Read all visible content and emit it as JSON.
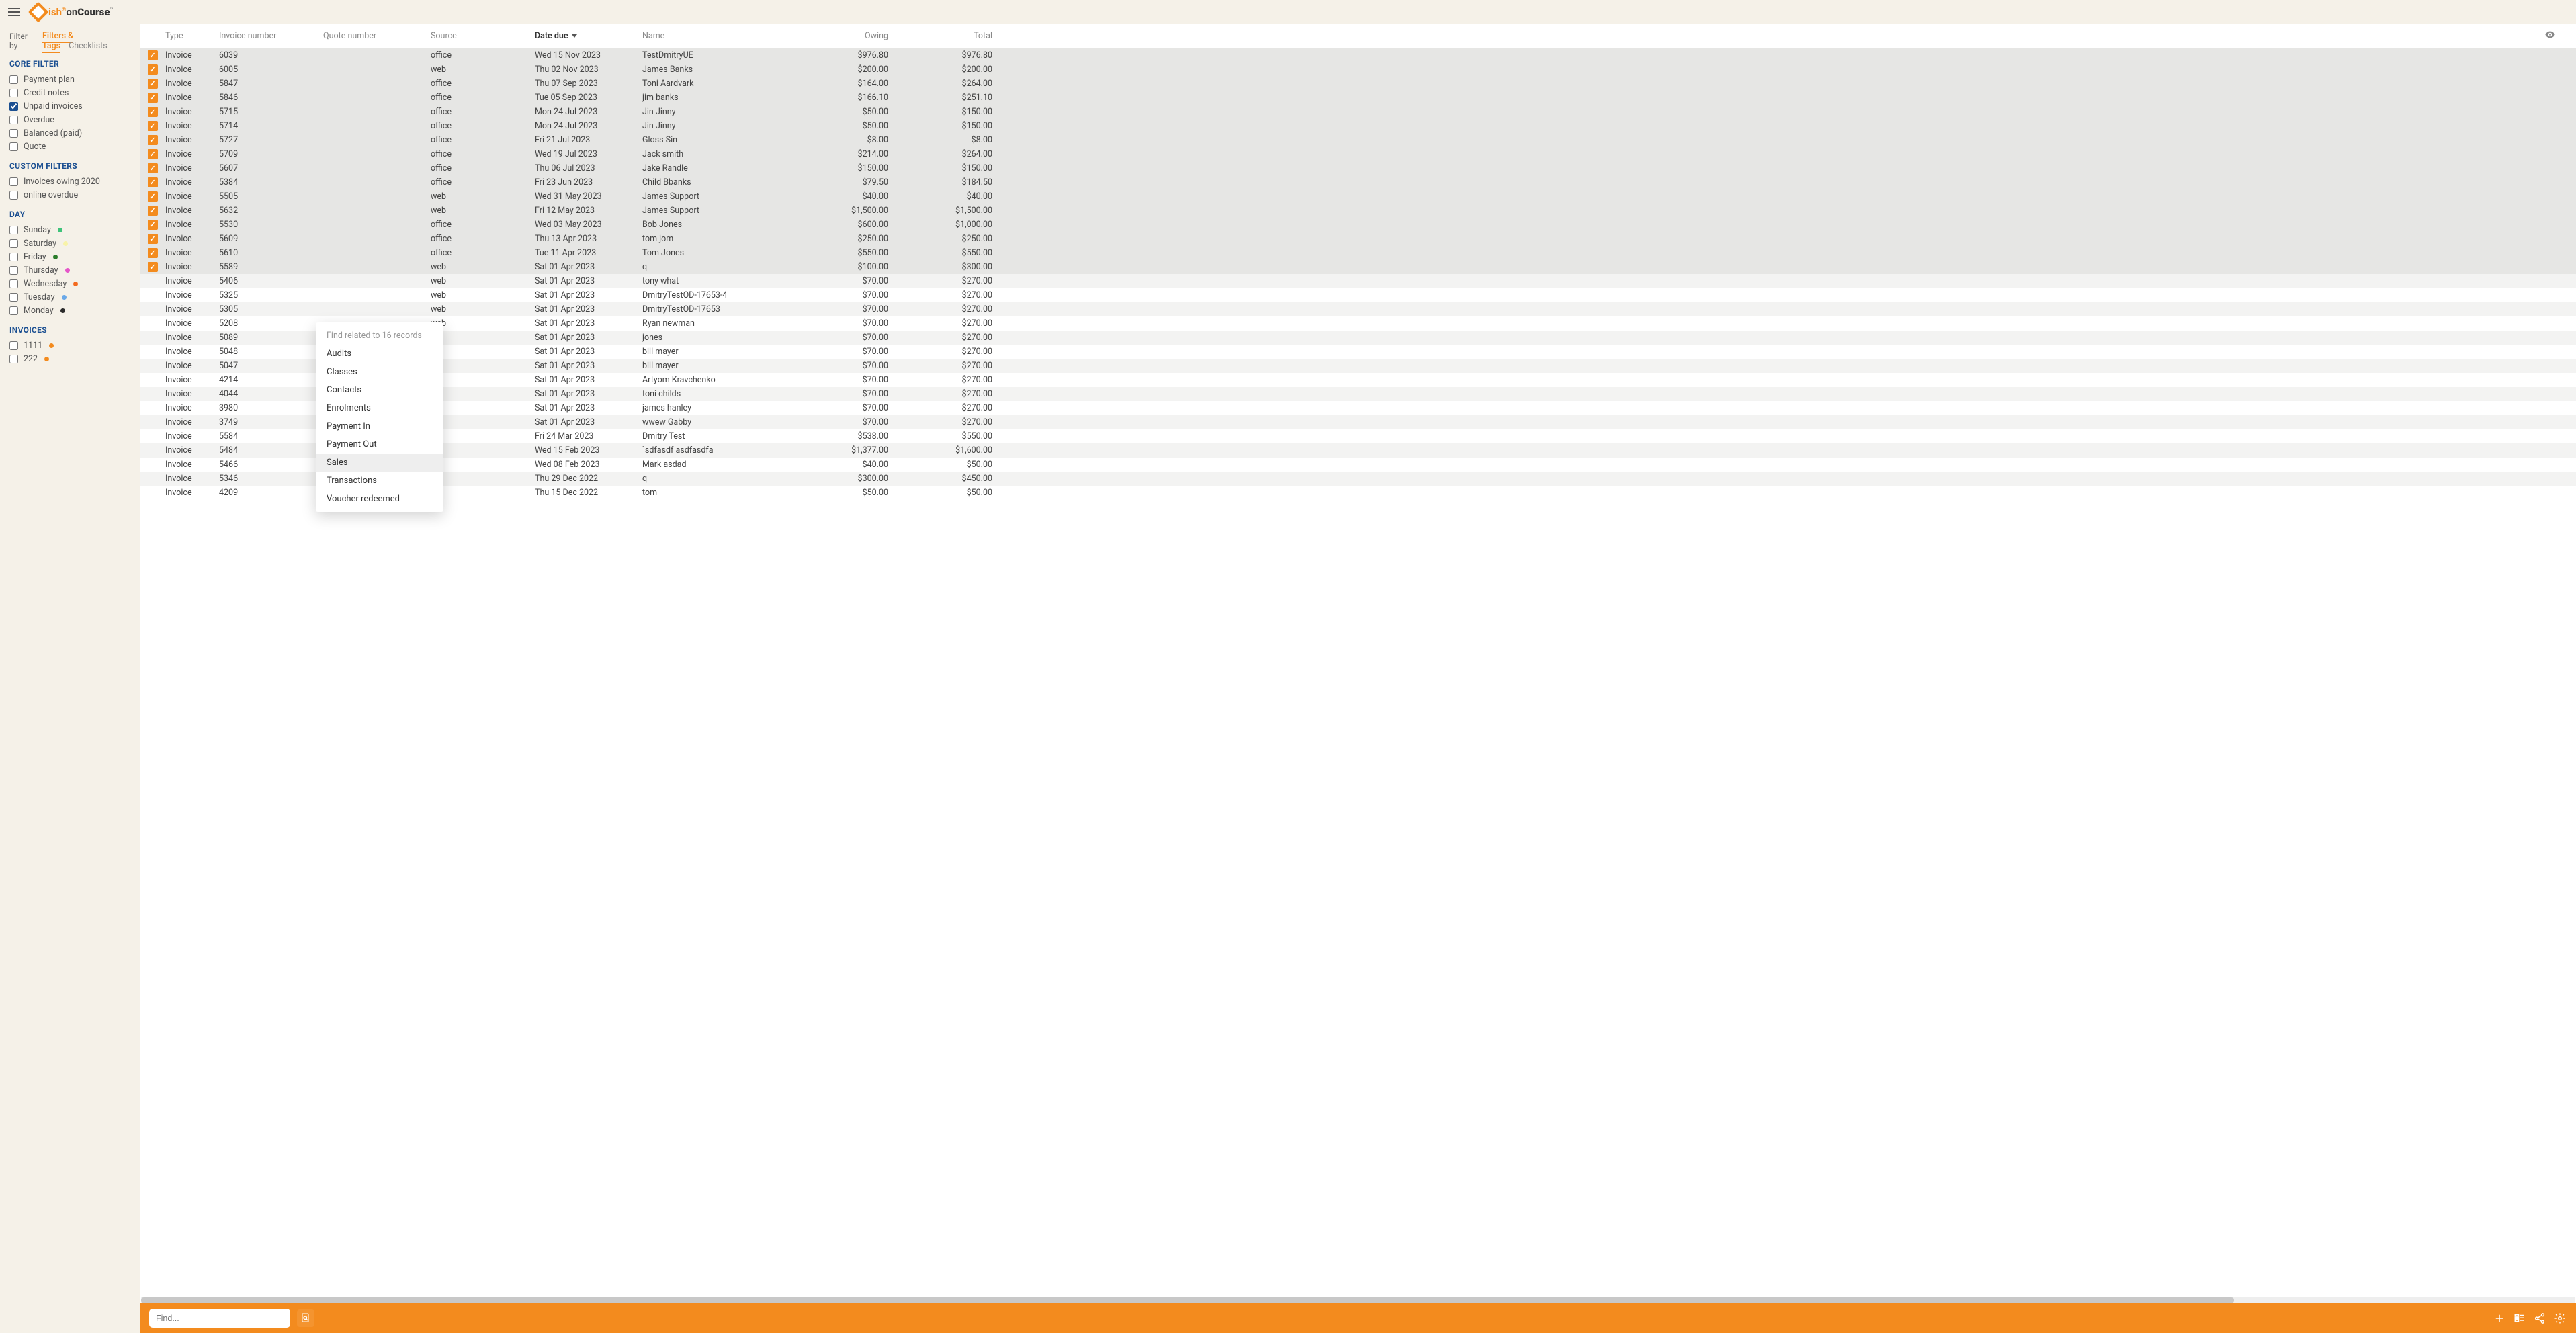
{
  "brand": {
    "name_prefix": "ish",
    "name_on": "on",
    "name_course": "Course"
  },
  "filterby": {
    "label": "Filter by",
    "tabs": [
      "Filters & Tags",
      "Checklists"
    ],
    "active": 0
  },
  "sections": {
    "core": {
      "title": "CORE FILTER",
      "items": [
        {
          "label": "Payment plan",
          "checked": false
        },
        {
          "label": "Credit notes",
          "checked": false
        },
        {
          "label": "Unpaid invoices",
          "checked": true
        },
        {
          "label": "Overdue",
          "checked": false
        },
        {
          "label": "Balanced (paid)",
          "checked": false
        },
        {
          "label": "Quote",
          "checked": false
        }
      ]
    },
    "custom": {
      "title": "CUSTOM FILTERS",
      "items": [
        {
          "label": "Invoices owing 2020",
          "checked": false
        },
        {
          "label": "online overdue",
          "checked": false
        }
      ]
    },
    "day": {
      "title": "DAY",
      "items": [
        {
          "label": "Sunday",
          "dot": "#3fc37a"
        },
        {
          "label": "Saturday",
          "dot": "#f8f3a8"
        },
        {
          "label": "Friday",
          "dot": "#2b7d2b"
        },
        {
          "label": "Thursday",
          "dot": "#e556c9"
        },
        {
          "label": "Wednesday",
          "dot": "#f36a1e"
        },
        {
          "label": "Tuesday",
          "dot": "#6aa9e8"
        },
        {
          "label": "Monday",
          "dot": "#2b2b2b"
        }
      ]
    },
    "invoices": {
      "title": "INVOICES",
      "items": [
        {
          "label": "1111",
          "dot": "#f38b1e"
        },
        {
          "label": "222",
          "dot": "#f38b1e"
        }
      ]
    }
  },
  "table": {
    "headers": {
      "type": "Type",
      "invoice_number": "Invoice number",
      "quote_number": "Quote number",
      "source": "Source",
      "date_due": "Date due",
      "name": "Name",
      "owing": "Owing",
      "total": "Total"
    },
    "rows": [
      {
        "sel": true,
        "type": "Invoice",
        "inv": "6039",
        "quote": "",
        "src": "office",
        "due": "Wed 15 Nov 2023",
        "name": "TestDmitryUE",
        "owing": "$976.80",
        "total": "$976.80"
      },
      {
        "sel": true,
        "type": "Invoice",
        "inv": "6005",
        "quote": "",
        "src": "web",
        "due": "Thu 02 Nov 2023",
        "name": "James Banks",
        "owing": "$200.00",
        "total": "$200.00"
      },
      {
        "sel": true,
        "type": "Invoice",
        "inv": "5847",
        "quote": "",
        "src": "office",
        "due": "Thu 07 Sep 2023",
        "name": "Toni Aardvark",
        "owing": "$164.00",
        "total": "$264.00"
      },
      {
        "sel": true,
        "type": "Invoice",
        "inv": "5846",
        "quote": "",
        "src": "office",
        "due": "Tue 05 Sep 2023",
        "name": "jim banks",
        "owing": "$166.10",
        "total": "$251.10"
      },
      {
        "sel": true,
        "type": "Invoice",
        "inv": "5715",
        "quote": "",
        "src": "office",
        "due": "Mon 24 Jul 2023",
        "name": "Jin Jinny",
        "owing": "$50.00",
        "total": "$150.00"
      },
      {
        "sel": true,
        "type": "Invoice",
        "inv": "5714",
        "quote": "",
        "src": "office",
        "due": "Mon 24 Jul 2023",
        "name": "Jin Jinny",
        "owing": "$50.00",
        "total": "$150.00"
      },
      {
        "sel": true,
        "type": "Invoice",
        "inv": "5727",
        "quote": "",
        "src": "office",
        "due": "Fri 21 Jul 2023",
        "name": "Gloss Sin",
        "owing": "$8.00",
        "total": "$8.00"
      },
      {
        "sel": true,
        "type": "Invoice",
        "inv": "5709",
        "quote": "",
        "src": "office",
        "due": "Wed 19 Jul 2023",
        "name": "Jack smith",
        "owing": "$214.00",
        "total": "$264.00"
      },
      {
        "sel": true,
        "type": "Invoice",
        "inv": "5607",
        "quote": "",
        "src": "office",
        "due": "Thu 06 Jul 2023",
        "name": "Jake Randle",
        "owing": "$150.00",
        "total": "$150.00"
      },
      {
        "sel": true,
        "type": "Invoice",
        "inv": "5384",
        "quote": "",
        "src": "office",
        "due": "Fri 23 Jun 2023",
        "name": "Child Bbanks",
        "owing": "$79.50",
        "total": "$184.50"
      },
      {
        "sel": true,
        "type": "Invoice",
        "inv": "5505",
        "quote": "",
        "src": "web",
        "due": "Wed 31 May 2023",
        "name": "James Support",
        "owing": "$40.00",
        "total": "$40.00"
      },
      {
        "sel": true,
        "type": "Invoice",
        "inv": "5632",
        "quote": "",
        "src": "web",
        "due": "Fri 12 May 2023",
        "name": "James Support",
        "owing": "$1,500.00",
        "total": "$1,500.00"
      },
      {
        "sel": true,
        "type": "Invoice",
        "inv": "5530",
        "quote": "",
        "src": "office",
        "due": "Wed 03 May 2023",
        "name": "Bob Jones",
        "owing": "$600.00",
        "total": "$1,000.00"
      },
      {
        "sel": true,
        "type": "Invoice",
        "inv": "5609",
        "quote": "",
        "src": "office",
        "due": "Thu 13 Apr 2023",
        "name": "tom jom",
        "owing": "$250.00",
        "total": "$250.00"
      },
      {
        "sel": true,
        "type": "Invoice",
        "inv": "5610",
        "quote": "",
        "src": "office",
        "due": "Tue 11 Apr 2023",
        "name": "Tom Jones",
        "owing": "$550.00",
        "total": "$550.00"
      },
      {
        "sel": true,
        "type": "Invoice",
        "inv": "5589",
        "quote": "",
        "src": "web",
        "due": "Sat 01 Apr 2023",
        "name": "q",
        "owing": "$100.00",
        "total": "$300.00"
      },
      {
        "sel": false,
        "type": "Invoice",
        "inv": "5406",
        "quote": "",
        "src": "web",
        "due": "Sat 01 Apr 2023",
        "name": "tony what",
        "owing": "$70.00",
        "total": "$270.00"
      },
      {
        "sel": false,
        "type": "Invoice",
        "inv": "5325",
        "quote": "",
        "src": "web",
        "due": "Sat 01 Apr 2023",
        "name": "DmitryTestOD-17653-4",
        "owing": "$70.00",
        "total": "$270.00"
      },
      {
        "sel": false,
        "type": "Invoice",
        "inv": "5305",
        "quote": "",
        "src": "web",
        "due": "Sat 01 Apr 2023",
        "name": "DmitryTestOD-17653",
        "owing": "$70.00",
        "total": "$270.00"
      },
      {
        "sel": false,
        "type": "Invoice",
        "inv": "5208",
        "quote": "",
        "src": "web",
        "due": "Sat 01 Apr 2023",
        "name": "Ryan newman",
        "owing": "$70.00",
        "total": "$270.00"
      },
      {
        "sel": false,
        "type": "Invoice",
        "inv": "5089",
        "quote": "",
        "src": "",
        "due": "Sat 01 Apr 2023",
        "name": "jones",
        "owing": "$70.00",
        "total": "$270.00"
      },
      {
        "sel": false,
        "type": "Invoice",
        "inv": "5048",
        "quote": "",
        "src": "",
        "due": "Sat 01 Apr 2023",
        "name": "bill mayer",
        "owing": "$70.00",
        "total": "$270.00"
      },
      {
        "sel": false,
        "type": "Invoice",
        "inv": "5047",
        "quote": "",
        "src": "",
        "due": "Sat 01 Apr 2023",
        "name": "bill mayer",
        "owing": "$70.00",
        "total": "$270.00"
      },
      {
        "sel": false,
        "type": "Invoice",
        "inv": "4214",
        "quote": "",
        "src": "",
        "due": "Sat 01 Apr 2023",
        "name": "Artyom Kravchenko",
        "owing": "$70.00",
        "total": "$270.00"
      },
      {
        "sel": false,
        "type": "Invoice",
        "inv": "4044",
        "quote": "",
        "src": "",
        "due": "Sat 01 Apr 2023",
        "name": "toni childs",
        "owing": "$70.00",
        "total": "$270.00"
      },
      {
        "sel": false,
        "type": "Invoice",
        "inv": "3980",
        "quote": "",
        "src": "",
        "due": "Sat 01 Apr 2023",
        "name": "james hanley",
        "owing": "$70.00",
        "total": "$270.00"
      },
      {
        "sel": false,
        "type": "Invoice",
        "inv": "3749",
        "quote": "",
        "src": "",
        "due": "Sat 01 Apr 2023",
        "name": "wwew Gabby",
        "owing": "$70.00",
        "total": "$270.00"
      },
      {
        "sel": false,
        "type": "Invoice",
        "inv": "5584",
        "quote": "",
        "src": "ce",
        "due": "Fri 24 Mar 2023",
        "name": "Dmitry Test",
        "owing": "$538.00",
        "total": "$550.00"
      },
      {
        "sel": false,
        "type": "Invoice",
        "inv": "5484",
        "quote": "",
        "src": "ce",
        "due": "Wed 15 Feb 2023",
        "name": "`sdfasdf asdfasdfa",
        "owing": "$1,377.00",
        "total": "$1,600.00"
      },
      {
        "sel": false,
        "type": "Invoice",
        "inv": "5466",
        "quote": "",
        "src": "ce",
        "due": "Wed 08 Feb 2023",
        "name": "Mark asdad",
        "owing": "$40.00",
        "total": "$50.00"
      },
      {
        "sel": false,
        "type": "Invoice",
        "inv": "5346",
        "quote": "",
        "src": "ce",
        "due": "Thu 29 Dec 2022",
        "name": "q",
        "owing": "$300.00",
        "total": "$450.00"
      },
      {
        "sel": false,
        "type": "Invoice",
        "inv": "4209",
        "quote": "",
        "src": "ce",
        "due": "Thu 15 Dec 2022",
        "name": "tom",
        "owing": "$50.00",
        "total": "$50.00"
      }
    ]
  },
  "context_menu": {
    "header": "Find related to 16 records",
    "items": [
      "Audits",
      "Classes",
      "Contacts",
      "Enrolments",
      "Payment In",
      "Payment Out",
      "Sales",
      "Transactions",
      "Voucher redeemed"
    ],
    "hover_index": 6
  },
  "footer": {
    "search_placeholder": "Find..."
  }
}
